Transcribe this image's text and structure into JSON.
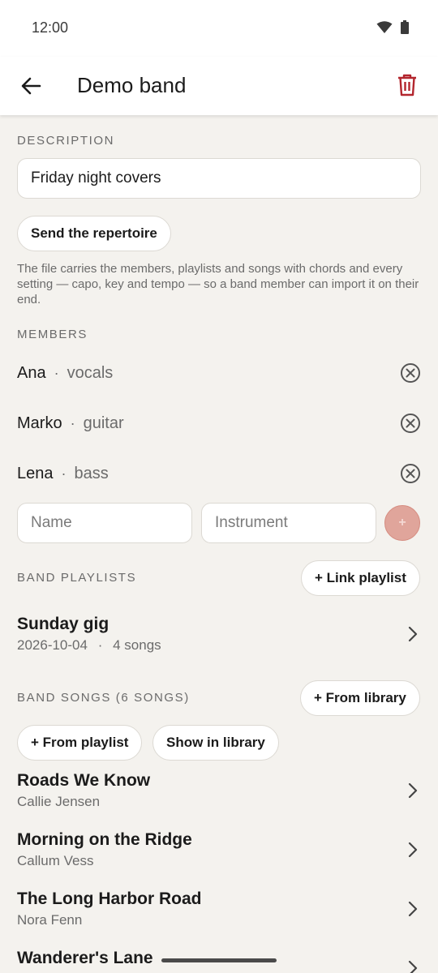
{
  "status": {
    "time": "12:00"
  },
  "header": {
    "title": "Demo band"
  },
  "description": {
    "label": "DESCRIPTION",
    "value": "Friday night covers",
    "send_button": "Send the repertoire",
    "helper": "The file carries the members, playlists and songs with chords and every setting — capo, key and tempo — so a band member can import it on their end."
  },
  "members": {
    "label": "MEMBERS",
    "items": [
      {
        "name": "Ana",
        "instrument": "vocals"
      },
      {
        "name": "Marko",
        "instrument": "guitar"
      },
      {
        "name": "Lena",
        "instrument": "bass"
      }
    ],
    "name_placeholder": "Name",
    "instrument_placeholder": "Instrument",
    "add_symbol": "+",
    "separator": "·"
  },
  "playlists": {
    "label": "BAND PLAYLISTS",
    "link_button": "+ Link playlist",
    "items": [
      {
        "title": "Sunday gig",
        "date": "2026-10-04",
        "count": "4 songs"
      }
    ]
  },
  "songs": {
    "label": "BAND SONGS (6 SONGS)",
    "from_library_button": "+ From library",
    "from_playlist_button": "+ From playlist",
    "show_library_button": "Show in library",
    "items": [
      {
        "title": "Roads We Know",
        "artist": "Callie Jensen"
      },
      {
        "title": "Morning on the Ridge",
        "artist": "Callum Vess"
      },
      {
        "title": "The Long Harbor Road",
        "artist": "Nora Fenn"
      },
      {
        "title": "Wanderer's Lane",
        "artist": ""
      }
    ]
  },
  "colors": {
    "accent": "#b3262e",
    "background": "#f4f2ee",
    "add_button": "#e0a59b"
  },
  "icons": [
    "wifi-icon",
    "battery-icon",
    "back-arrow-icon",
    "trash-icon",
    "remove-circle-icon",
    "chevron-right-icon"
  ]
}
